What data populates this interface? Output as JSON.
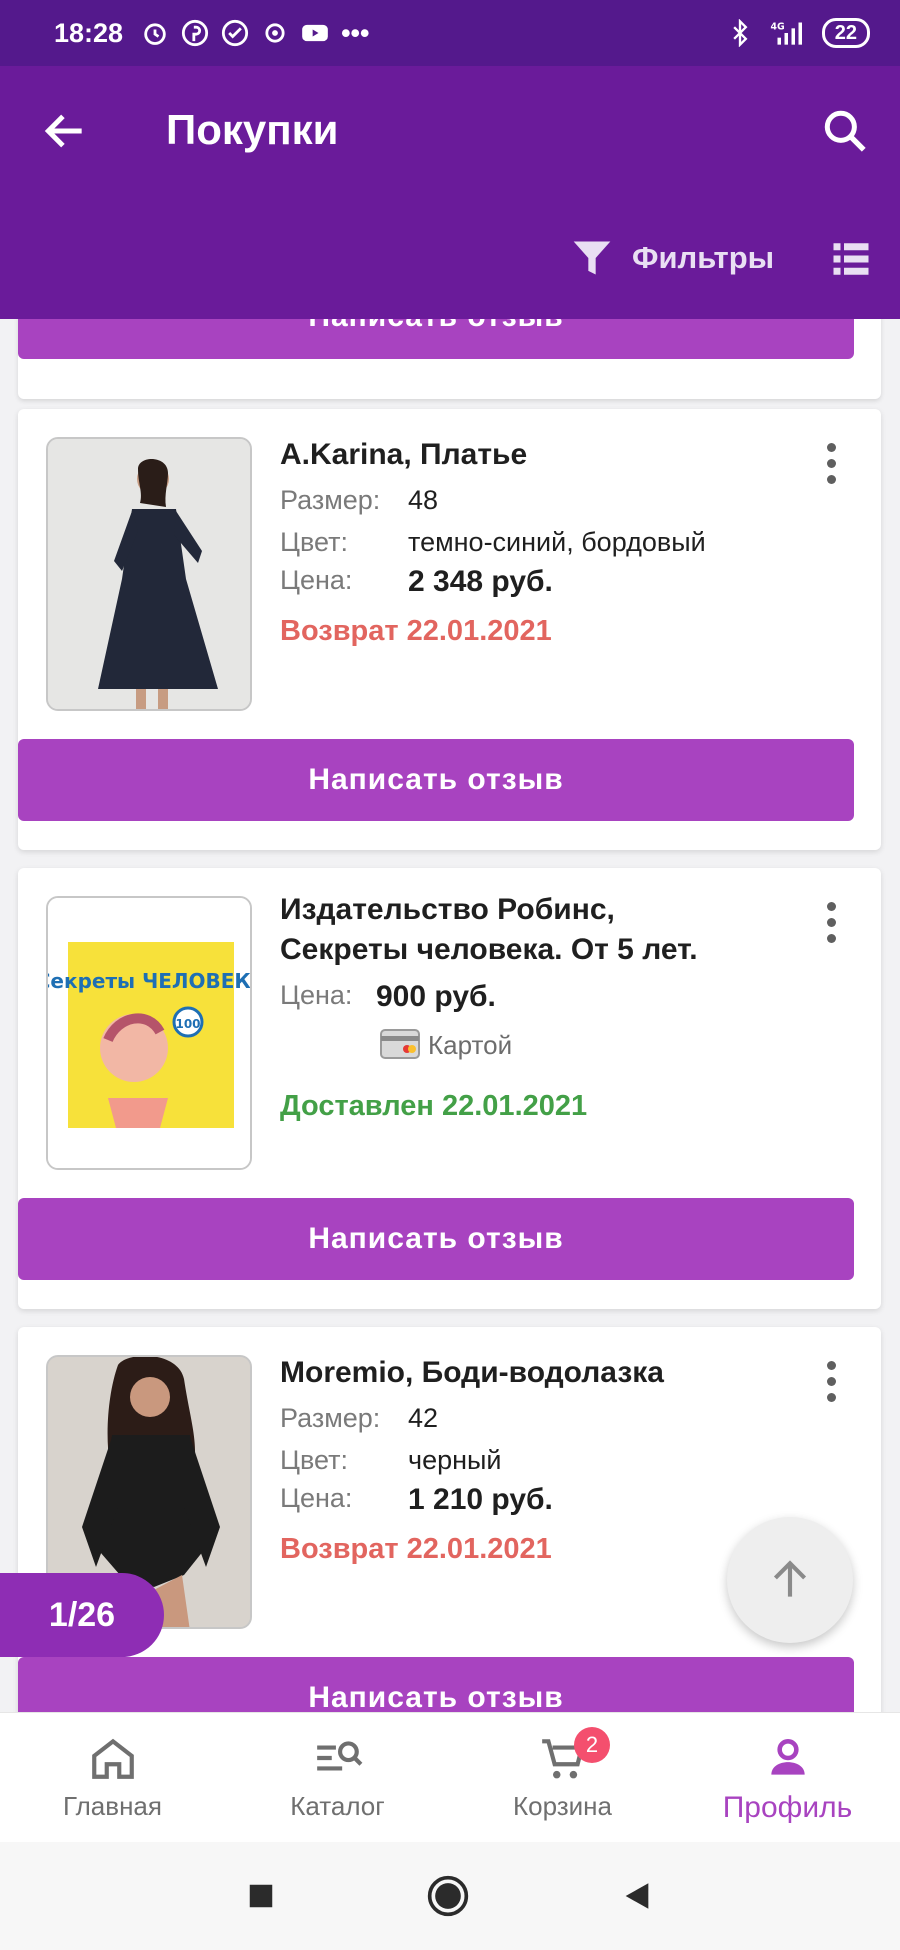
{
  "status_bar": {
    "time": "18:28",
    "battery": "22",
    "network": "4G"
  },
  "app_bar": {
    "title": "Покупки",
    "filters_label": "Фильтры"
  },
  "colors": {
    "header": "#6a1b9a",
    "status_bar": "#54198c",
    "accent": "#a843c0",
    "return_status": "#e2655f",
    "delivered_status": "#43a047"
  },
  "review_button_label": "Написать отзыв",
  "orders": [
    {
      "title": "A.Karina, Платье",
      "size_label": "Размер:",
      "size": "48",
      "color_label": "Цвет:",
      "color": "темно-синий, бордовый",
      "price_label": "Цена:",
      "price": "2 348 руб.",
      "status": "Возврат 22.01.2021"
    },
    {
      "title_line1": "Издательство Робинс,",
      "title_line2": "Секреты человека. От 5 лет.",
      "price_label": "Цена:",
      "price": "900 руб.",
      "payment": "Картой",
      "status": "Доставлен 22.01.2021",
      "book_cover_title": "Секреты ЧЕЛОВЕКА",
      "book_cover_badge": "100"
    },
    {
      "title": "Moremio, Боди-водолазка",
      "size_label": "Размер:",
      "size": "42",
      "color_label": "Цвет:",
      "color": "черный",
      "price_label": "Цена:",
      "price": "1 210 руб.",
      "status": "Возврат 22.01.2021"
    }
  ],
  "page_counter": "1/26",
  "bottom_nav": {
    "home": "Главная",
    "catalog": "Каталог",
    "cart": "Корзина",
    "cart_badge": "2",
    "profile": "Профиль"
  }
}
